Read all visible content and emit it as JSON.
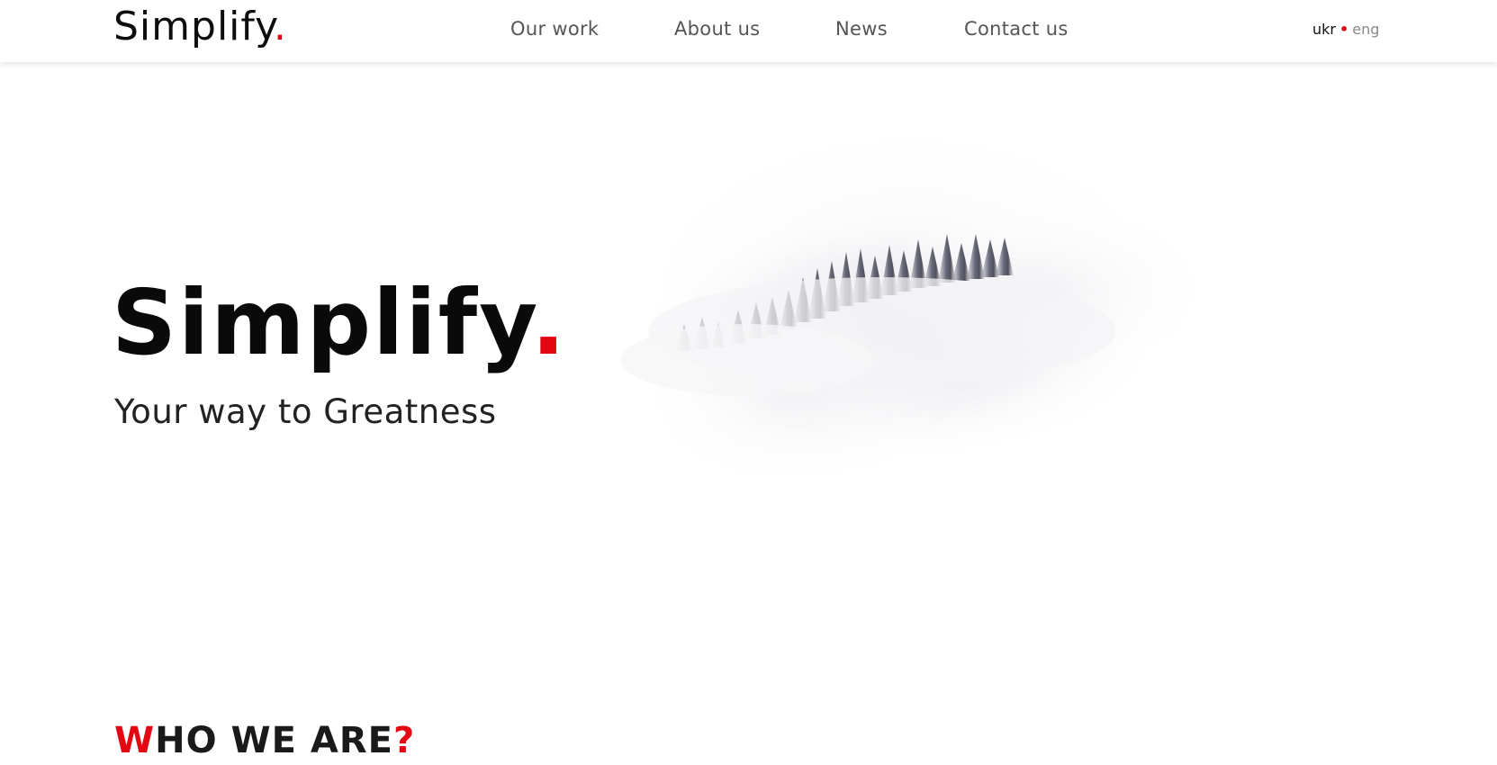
{
  "header": {
    "logo_text": "Simplify",
    "logo_dot": ".",
    "nav": [
      {
        "label": "Our work"
      },
      {
        "label": "About us"
      },
      {
        "label": "News"
      },
      {
        "label": "Contact us"
      }
    ],
    "lang": {
      "active": "ukr",
      "separator": "•",
      "other": "eng"
    }
  },
  "hero": {
    "title": "Simplify",
    "title_dot": ".",
    "subtitle": "Your way to Greatness",
    "image_icon": "misty-forest-image"
  },
  "section": {
    "title_first_letter": "W",
    "title_rest": "HO WE ARE",
    "title_mark": "?"
  },
  "colors": {
    "accent": "#e30613",
    "text": "#111111",
    "nav_text": "#555555"
  }
}
